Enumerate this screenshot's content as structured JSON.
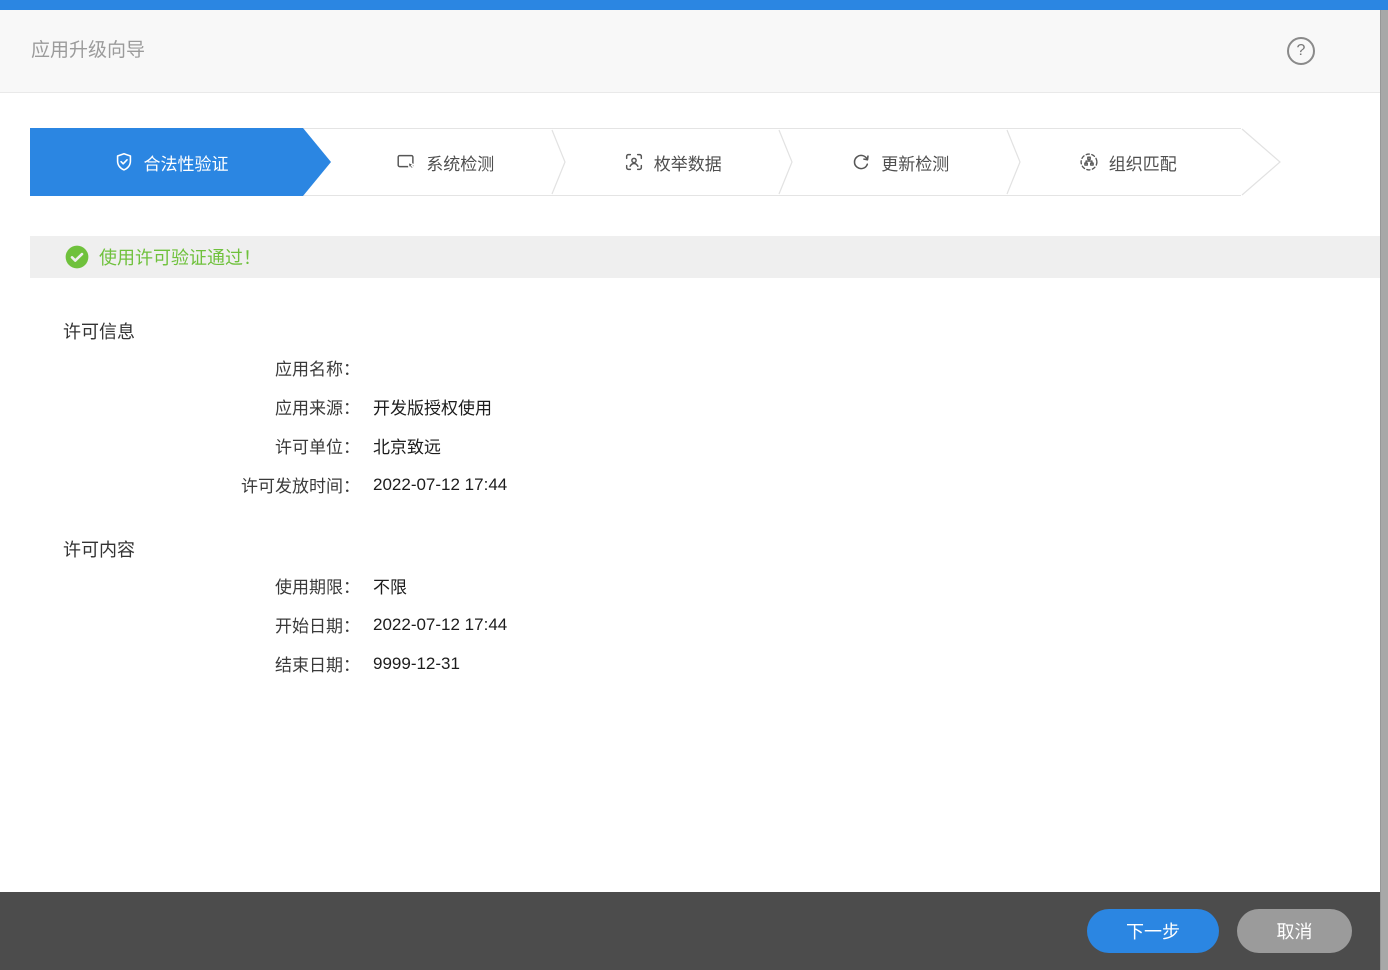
{
  "window": {
    "title": "应用升级向导",
    "help_icon": "help-circle-icon"
  },
  "steps": [
    {
      "label": "合法性验证",
      "icon": "shield-check-icon",
      "state": "active"
    },
    {
      "label": "系统检测",
      "icon": "monitor-cursor-icon",
      "state": "pending"
    },
    {
      "label": "枚举数据",
      "icon": "enumerate-person-icon",
      "state": "pending"
    },
    {
      "label": "更新检测",
      "icon": "refresh-icon",
      "state": "pending"
    },
    {
      "label": "组织匹配",
      "icon": "org-match-icon",
      "state": "pending"
    }
  ],
  "status": {
    "message": "使用许可验证通过！",
    "type": "success",
    "icon": "check-circle-icon"
  },
  "sections": [
    {
      "title": "许可信息",
      "rows": [
        {
          "label": "应用名称：",
          "value": ""
        },
        {
          "label": "应用来源：",
          "value": "开发版授权使用"
        },
        {
          "label": "许可单位：",
          "value": "北京致远"
        },
        {
          "label": "许可发放时间：",
          "value": "2022-07-12 17:44"
        }
      ]
    },
    {
      "title": "许可内容",
      "rows": [
        {
          "label": "使用期限：",
          "value": "不限"
        },
        {
          "label": "开始日期：",
          "value": "2022-07-12 17:44"
        },
        {
          "label": "结束日期：",
          "value": "9999-12-31"
        }
      ]
    }
  ],
  "footer": {
    "next_label": "下一步",
    "cancel_label": "取消"
  },
  "colors": {
    "accent": "#2b86e2",
    "success": "#6fc13c",
    "footer_bg": "#4c4c4c",
    "cancel_bg": "#9b9b9b",
    "status_bg": "#efefef",
    "header_bg": "#f8f8f8"
  }
}
